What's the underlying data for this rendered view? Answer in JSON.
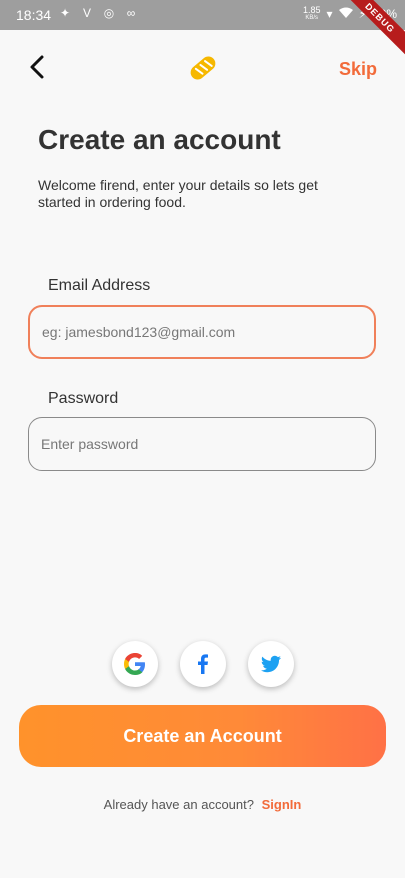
{
  "status_bar": {
    "time": "18:34",
    "net_speed_value": "1.85",
    "net_speed_unit": "KB/s",
    "battery": "40%",
    "debug_banner": "DEBUG"
  },
  "header": {
    "back_icon": "chevron-left-icon",
    "logo_icon": "bread-icon",
    "skip_label": "Skip"
  },
  "main": {
    "title": "Create an account",
    "subtitle": "Welcome firend, enter your details so lets get started in ordering food.",
    "email": {
      "label": "Email Address",
      "placeholder": "eg: jamesbond123@gmail.com",
      "value": ""
    },
    "password": {
      "label": "Password",
      "placeholder": "Enter password",
      "value": ""
    }
  },
  "social": [
    "google-icon",
    "facebook-icon",
    "twitter-icon"
  ],
  "footer": {
    "create_button_label": "Create an Account",
    "signin_prompt": "Already have an account?",
    "signin_link": "SignIn"
  },
  "colors": {
    "accent": "#F26B3A",
    "button_gradient_start": "#FF922B",
    "button_gradient_end": "#FF7146",
    "background": "#F8F8F8"
  }
}
